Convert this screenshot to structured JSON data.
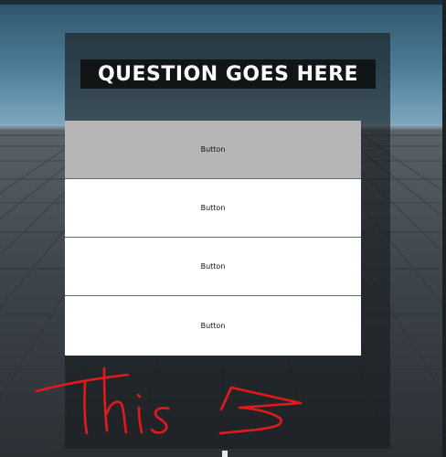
{
  "question": {
    "text": "QUESTION GOES HERE"
  },
  "buttons": [
    {
      "label": "Button",
      "state": "hovered"
    },
    {
      "label": "Button",
      "state": "normal"
    },
    {
      "label": "Button",
      "state": "normal"
    },
    {
      "label": "Button",
      "state": "normal"
    }
  ],
  "colors": {
    "frame": "#181c1f",
    "question_bg": "#111516",
    "button_bg": "#ffffff",
    "button_hover_bg": "#b6b6b6",
    "annotation": "#e21a1a"
  }
}
